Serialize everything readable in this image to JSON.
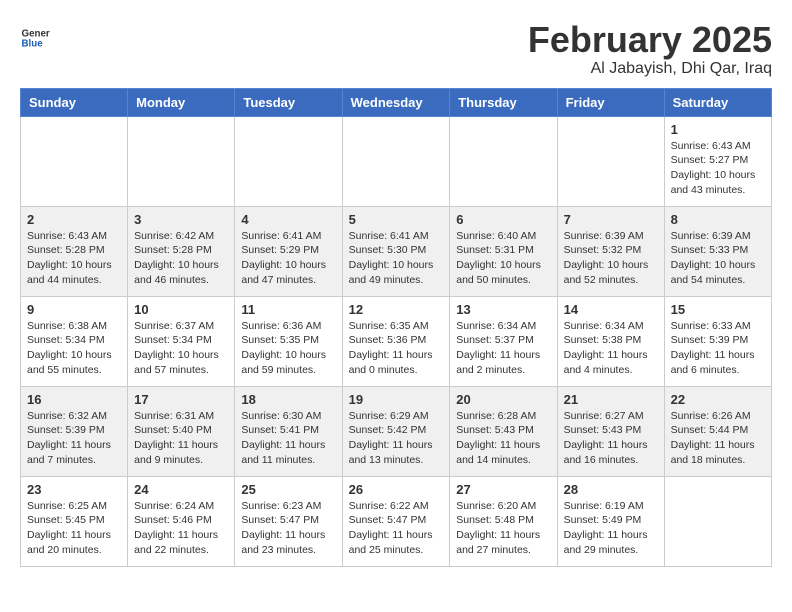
{
  "header": {
    "logo_line1": "General",
    "logo_line2": "Blue",
    "month_title": "February 2025",
    "location": "Al Jabayish, Dhi Qar, Iraq"
  },
  "weekdays": [
    "Sunday",
    "Monday",
    "Tuesday",
    "Wednesday",
    "Thursday",
    "Friday",
    "Saturday"
  ],
  "weeks": [
    [
      {
        "day": "",
        "info": ""
      },
      {
        "day": "",
        "info": ""
      },
      {
        "day": "",
        "info": ""
      },
      {
        "day": "",
        "info": ""
      },
      {
        "day": "",
        "info": ""
      },
      {
        "day": "",
        "info": ""
      },
      {
        "day": "1",
        "info": "Sunrise: 6:43 AM\nSunset: 5:27 PM\nDaylight: 10 hours\nand 43 minutes."
      }
    ],
    [
      {
        "day": "2",
        "info": "Sunrise: 6:43 AM\nSunset: 5:28 PM\nDaylight: 10 hours\nand 44 minutes."
      },
      {
        "day": "3",
        "info": "Sunrise: 6:42 AM\nSunset: 5:28 PM\nDaylight: 10 hours\nand 46 minutes."
      },
      {
        "day": "4",
        "info": "Sunrise: 6:41 AM\nSunset: 5:29 PM\nDaylight: 10 hours\nand 47 minutes."
      },
      {
        "day": "5",
        "info": "Sunrise: 6:41 AM\nSunset: 5:30 PM\nDaylight: 10 hours\nand 49 minutes."
      },
      {
        "day": "6",
        "info": "Sunrise: 6:40 AM\nSunset: 5:31 PM\nDaylight: 10 hours\nand 50 minutes."
      },
      {
        "day": "7",
        "info": "Sunrise: 6:39 AM\nSunset: 5:32 PM\nDaylight: 10 hours\nand 52 minutes."
      },
      {
        "day": "8",
        "info": "Sunrise: 6:39 AM\nSunset: 5:33 PM\nDaylight: 10 hours\nand 54 minutes."
      }
    ],
    [
      {
        "day": "9",
        "info": "Sunrise: 6:38 AM\nSunset: 5:34 PM\nDaylight: 10 hours\nand 55 minutes."
      },
      {
        "day": "10",
        "info": "Sunrise: 6:37 AM\nSunset: 5:34 PM\nDaylight: 10 hours\nand 57 minutes."
      },
      {
        "day": "11",
        "info": "Sunrise: 6:36 AM\nSunset: 5:35 PM\nDaylight: 10 hours\nand 59 minutes."
      },
      {
        "day": "12",
        "info": "Sunrise: 6:35 AM\nSunset: 5:36 PM\nDaylight: 11 hours\nand 0 minutes."
      },
      {
        "day": "13",
        "info": "Sunrise: 6:34 AM\nSunset: 5:37 PM\nDaylight: 11 hours\nand 2 minutes."
      },
      {
        "day": "14",
        "info": "Sunrise: 6:34 AM\nSunset: 5:38 PM\nDaylight: 11 hours\nand 4 minutes."
      },
      {
        "day": "15",
        "info": "Sunrise: 6:33 AM\nSunset: 5:39 PM\nDaylight: 11 hours\nand 6 minutes."
      }
    ],
    [
      {
        "day": "16",
        "info": "Sunrise: 6:32 AM\nSunset: 5:39 PM\nDaylight: 11 hours\nand 7 minutes."
      },
      {
        "day": "17",
        "info": "Sunrise: 6:31 AM\nSunset: 5:40 PM\nDaylight: 11 hours\nand 9 minutes."
      },
      {
        "day": "18",
        "info": "Sunrise: 6:30 AM\nSunset: 5:41 PM\nDaylight: 11 hours\nand 11 minutes."
      },
      {
        "day": "19",
        "info": "Sunrise: 6:29 AM\nSunset: 5:42 PM\nDaylight: 11 hours\nand 13 minutes."
      },
      {
        "day": "20",
        "info": "Sunrise: 6:28 AM\nSunset: 5:43 PM\nDaylight: 11 hours\nand 14 minutes."
      },
      {
        "day": "21",
        "info": "Sunrise: 6:27 AM\nSunset: 5:43 PM\nDaylight: 11 hours\nand 16 minutes."
      },
      {
        "day": "22",
        "info": "Sunrise: 6:26 AM\nSunset: 5:44 PM\nDaylight: 11 hours\nand 18 minutes."
      }
    ],
    [
      {
        "day": "23",
        "info": "Sunrise: 6:25 AM\nSunset: 5:45 PM\nDaylight: 11 hours\nand 20 minutes."
      },
      {
        "day": "24",
        "info": "Sunrise: 6:24 AM\nSunset: 5:46 PM\nDaylight: 11 hours\nand 22 minutes."
      },
      {
        "day": "25",
        "info": "Sunrise: 6:23 AM\nSunset: 5:47 PM\nDaylight: 11 hours\nand 23 minutes."
      },
      {
        "day": "26",
        "info": "Sunrise: 6:22 AM\nSunset: 5:47 PM\nDaylight: 11 hours\nand 25 minutes."
      },
      {
        "day": "27",
        "info": "Sunrise: 6:20 AM\nSunset: 5:48 PM\nDaylight: 11 hours\nand 27 minutes."
      },
      {
        "day": "28",
        "info": "Sunrise: 6:19 AM\nSunset: 5:49 PM\nDaylight: 11 hours\nand 29 minutes."
      },
      {
        "day": "",
        "info": ""
      }
    ]
  ]
}
